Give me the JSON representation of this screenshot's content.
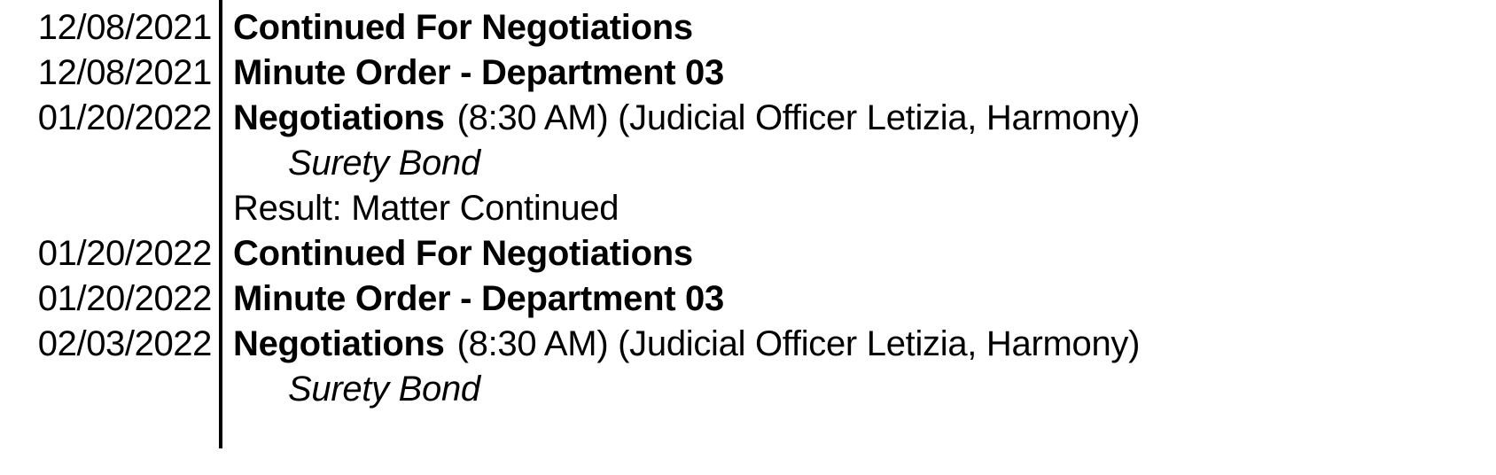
{
  "document": {
    "type": "court-register-of-actions",
    "background_color": "#ffffff",
    "text_color": "#000000",
    "divider_color": "#000000"
  },
  "rows": [
    {
      "date": "12/08/2021",
      "kind": "event",
      "title": "Continued For Negotiations",
      "detail": ""
    },
    {
      "date": "12/08/2021",
      "kind": "event",
      "title": "Minute Order - Department 03",
      "detail": ""
    },
    {
      "date": "01/20/2022",
      "kind": "event",
      "title": "Negotiations",
      "detail": "(8:30 AM) (Judicial Officer Letizia, Harmony)"
    },
    {
      "date": "",
      "kind": "subline",
      "title": "Surety Bond",
      "detail": ""
    },
    {
      "date": "",
      "kind": "result",
      "title": "Result: Matter Continued",
      "detail": ""
    },
    {
      "date": "01/20/2022",
      "kind": "event",
      "title": "Continued For Negotiations",
      "detail": ""
    },
    {
      "date": "01/20/2022",
      "kind": "event",
      "title": "Minute Order - Department 03",
      "detail": ""
    },
    {
      "date": "02/03/2022",
      "kind": "event",
      "title": "Negotiations",
      "detail": "(8:30 AM) (Judicial Officer Letizia, Harmony)"
    },
    {
      "date": "",
      "kind": "subline",
      "title": "Surety Bond",
      "detail": ""
    }
  ]
}
